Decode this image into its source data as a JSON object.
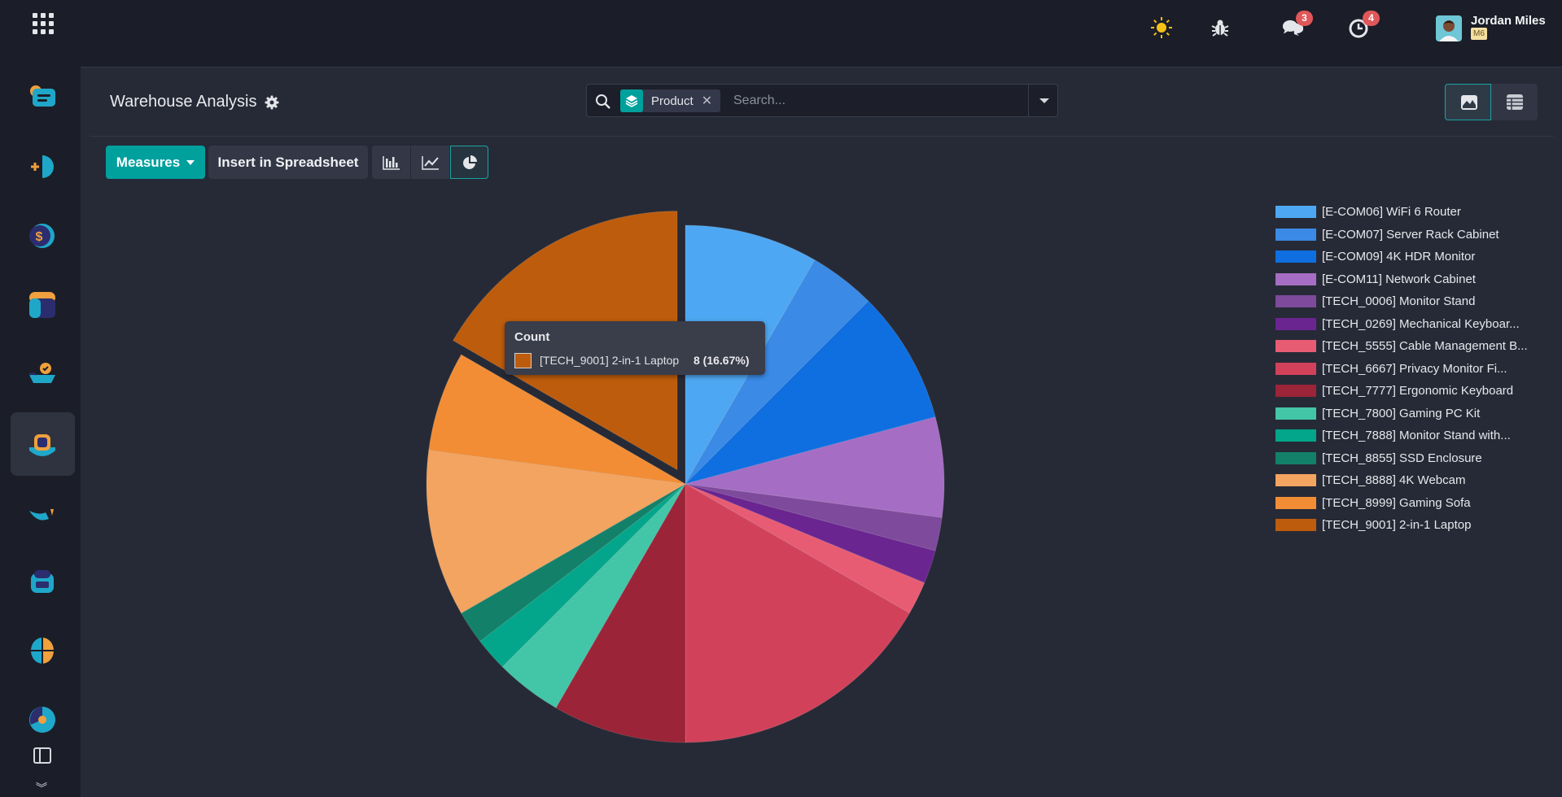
{
  "topbar": {
    "user_name": "Jordan Miles",
    "user_db": "M6",
    "messages_count": "3",
    "activities_count": "4"
  },
  "control_panel": {
    "title": "Warehouse Analysis",
    "facet_label": "Product",
    "search_placeholder": "Search...",
    "measures_label": "Measures",
    "spreadsheet_label": "Insert in Spreadsheet"
  },
  "tooltip": {
    "title": "Count",
    "label": "[TECH_9001] 2-in-1 Laptop",
    "value": "8 (16.67%)"
  },
  "colors": {
    "accent": "#00a09d",
    "background": "#262a36",
    "sidebar": "#1b1e28"
  },
  "chart_data": {
    "type": "pie",
    "title": "",
    "measure": "Count",
    "legend_position": "right",
    "highlighted": "[TECH_9001] 2-in-1 Laptop",
    "categories": [
      "[E-COM06] WiFi 6 Router",
      "[E-COM07] Server Rack Cabinet",
      "[E-COM09] 4K HDR Monitor",
      "[E-COM11] Network Cabinet",
      "[TECH_0006] Monitor Stand",
      "[TECH_0269] Mechanical Keyboar...",
      "[TECH_5555] Cable Management B...",
      "[TECH_6667] Privacy Monitor Fi...",
      "[TECH_7777] Ergonomic Keyboard",
      "[TECH_7800] Gaming PC Kit",
      "[TECH_7888] Monitor Stand with...",
      "[TECH_8855] SSD Enclosure",
      "[TECH_8888] 4K Webcam",
      "[TECH_8999] Gaming Sofa",
      "[TECH_9001] 2-in-1 Laptop"
    ],
    "values": [
      4,
      2,
      4,
      3,
      1,
      1,
      1,
      8,
      4,
      2,
      1,
      1,
      5,
      3,
      8
    ],
    "colors": [
      "#4ea7f2",
      "#3a8ae6",
      "#0f6fe0",
      "#a66dc4",
      "#7e4a9c",
      "#6a2590",
      "#e85c73",
      "#d1425a",
      "#9b2438",
      "#43c5a8",
      "#03a68a",
      "#138169",
      "#f2a460",
      "#f28d35",
      "#bd5c0c"
    ]
  }
}
